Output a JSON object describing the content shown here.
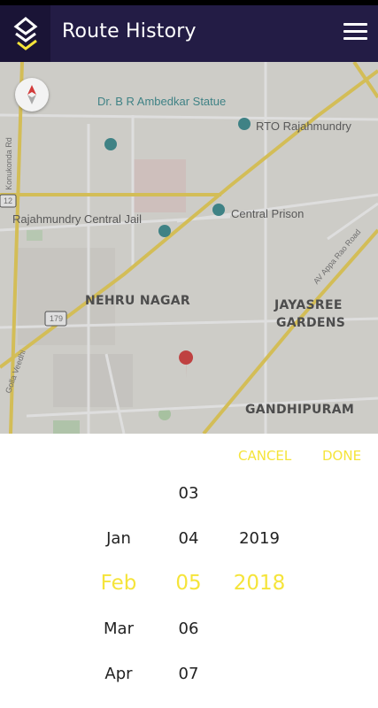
{
  "app_bar": {
    "title": "Route History",
    "logo_icon": "app-logo-icon",
    "menu_icon": "hamburger-menu-icon"
  },
  "map": {
    "labels": {
      "ambedkar_statue": "Dr. B R Ambedkar Statue",
      "rto": "RTO Rajahmundry",
      "central_jail": "Rajahmundry Central Jail",
      "central_prison": "Central Prison",
      "nehru_nagar": "NEHRU NAGAR",
      "jayasree_line1": "JAYASREE",
      "jayasree_line2": "GARDENS",
      "gandhipuram": "GANDHIPURAM",
      "konakonda_rd": "Konukonda Rd",
      "av_appa_rao_rd": "AV Appa Rao Road",
      "golla_veedhi": "Golla Veedhi",
      "shield_12": "12",
      "shield_179": "179"
    }
  },
  "picker": {
    "cancel_label": "CANCEL",
    "done_label": "DONE",
    "months": [
      "Jan",
      "Feb",
      "Mar",
      "Apr"
    ],
    "days": [
      "03",
      "04",
      "05",
      "06",
      "07"
    ],
    "years": [
      "2019",
      "2018"
    ],
    "selected": {
      "month": "Feb",
      "day": "05",
      "year": "2018"
    }
  },
  "colors": {
    "app_bar": "#231c45",
    "accent_yellow": "#f5e43a",
    "map_road_major": "#f2d75b",
    "poi_teal": "#3d8f93"
  }
}
